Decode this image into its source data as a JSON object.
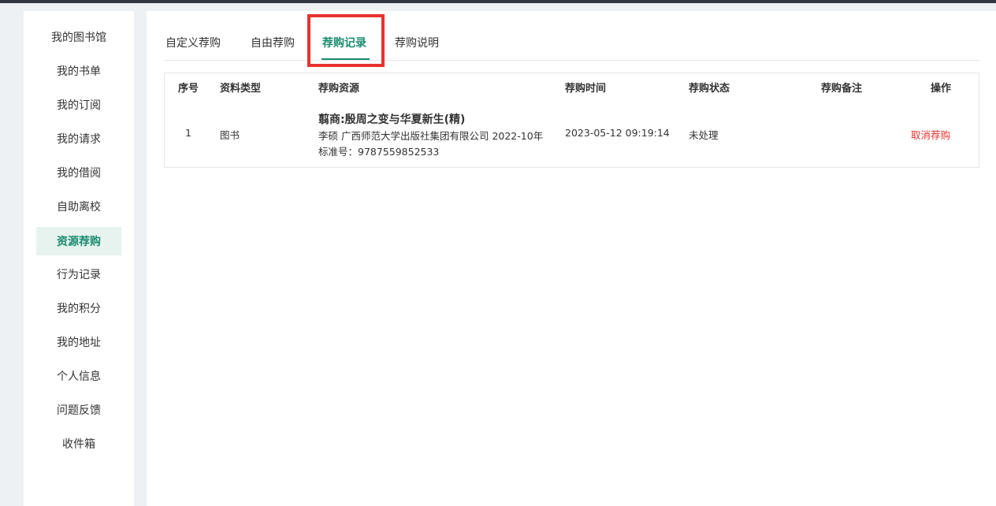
{
  "sidebar": {
    "items": [
      {
        "label": "我的图书馆"
      },
      {
        "label": "我的书单"
      },
      {
        "label": "我的订阅"
      },
      {
        "label": "我的请求"
      },
      {
        "label": "我的借阅"
      },
      {
        "label": "自助离校"
      },
      {
        "label": "资源荐购",
        "active": true
      },
      {
        "label": "行为记录"
      },
      {
        "label": "我的积分"
      },
      {
        "label": "我的地址"
      },
      {
        "label": "个人信息"
      },
      {
        "label": "问题反馈"
      },
      {
        "label": "收件箱"
      }
    ]
  },
  "tabs": [
    {
      "label": "自定义荐购"
    },
    {
      "label": "自由荐购"
    },
    {
      "label": "荐购记录",
      "active": true
    },
    {
      "label": "荐购说明"
    }
  ],
  "table": {
    "headers": {
      "index": "序号",
      "type": "资料类型",
      "resource": "荐购资源",
      "time": "荐购时间",
      "status": "荐购状态",
      "remark": "荐购备注",
      "action": "操作"
    },
    "rows": [
      {
        "index": "1",
        "type": "图书",
        "title": "翦商:殷周之变与华夏新生(精)",
        "meta": "李硕 广西师范大学出版社集团有限公司 2022-10年",
        "isbn": "标准号：9787559852533",
        "time": "2023-05-12 09:19:14",
        "status": "未处理",
        "remark": "",
        "action": "取消荐购"
      }
    ]
  },
  "colors": {
    "accent": "#1a8c6e",
    "danger": "#e8322e",
    "highlight_box": "#e8322e"
  }
}
